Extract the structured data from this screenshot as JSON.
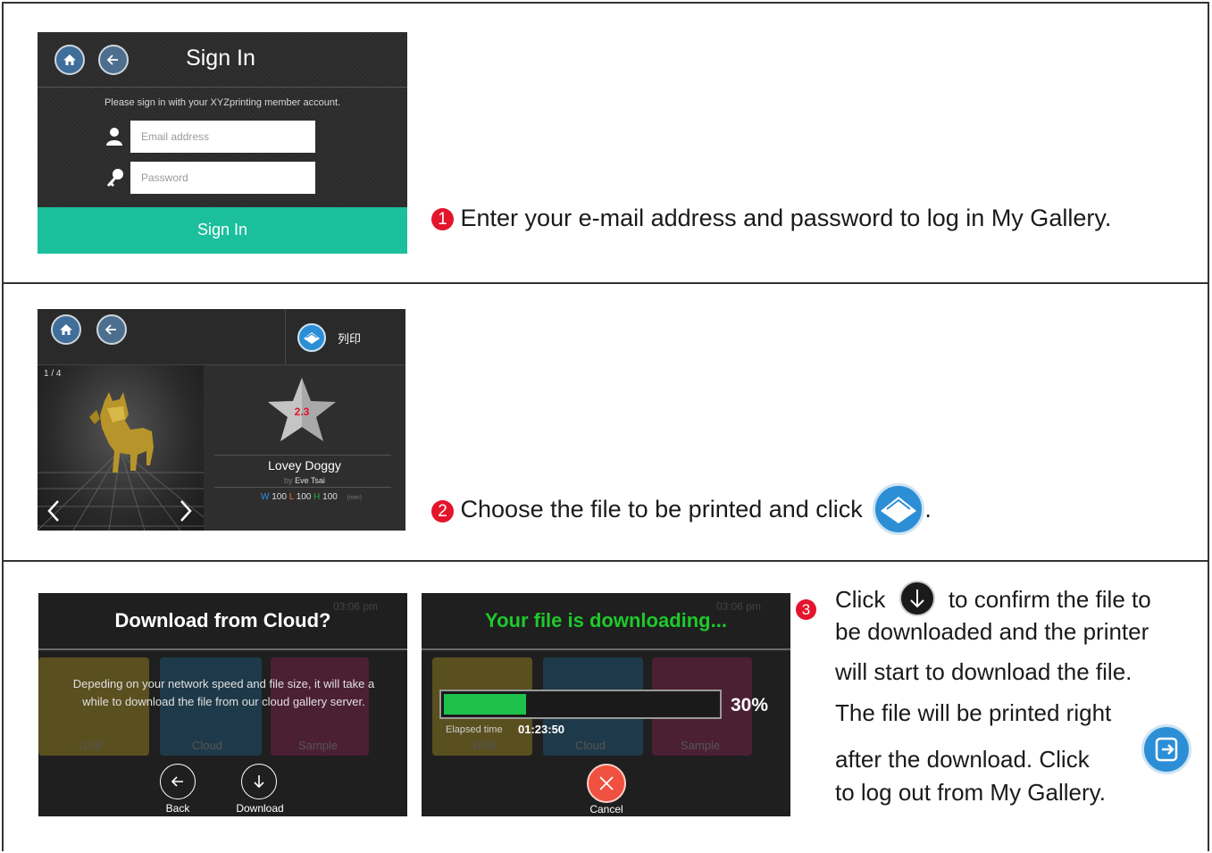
{
  "step1": {
    "number": "1",
    "text": "Enter your e-mail address and password to log in My Gallery.",
    "screen": {
      "title": "Sign In",
      "prompt": "Please sign in with your XYZprinting member account.",
      "email_placeholder": "Email address",
      "password_placeholder": "Password",
      "sign_in_button": "Sign In",
      "accent": "#1bbf9c"
    }
  },
  "step2": {
    "number": "2",
    "text_before": "Choose the file to be printed and click",
    "text_after": ".",
    "screen": {
      "print_label": "列印",
      "page_counter": "1 / 4",
      "rating": "2.3",
      "model_name": "Lovey Doggy",
      "by_label": "by",
      "author": "Eve Tsai",
      "dim_w_label": "W",
      "dim_w_value": "100",
      "dim_l_label": "L",
      "dim_l_value": "100",
      "dim_h_label": "H",
      "dim_h_value": "100",
      "dim_unit": "(mm)"
    }
  },
  "step3": {
    "number": "3",
    "line1_before": "Click",
    "line1_after": "to confirm the file to",
    "line2": "be downloaded and the printer",
    "line3": "will start to download the file.",
    "line4": "The file will be printed right",
    "line5": "after the download. Click",
    "line6": "to log out from My Gallery.",
    "screen_a": {
      "time": "03:06 pm",
      "title": "Download from Cloud?",
      "message": "Depeding on your network speed and file size, it will take a while to download the file from our cloud gallery server.",
      "tiles": [
        "USB",
        "Cloud",
        "Sample"
      ],
      "back_label": "Back",
      "download_label": "Download"
    },
    "screen_b": {
      "time": "03:06 pm",
      "title": "Your file is downloading...",
      "progress": 0.3,
      "progress_label": "30%",
      "elapsed_label": "Elapsed time",
      "elapsed_value": "01:23:50",
      "tiles": [
        "USB",
        "Cloud",
        "Sample"
      ],
      "cancel_label": "Cancel"
    }
  }
}
